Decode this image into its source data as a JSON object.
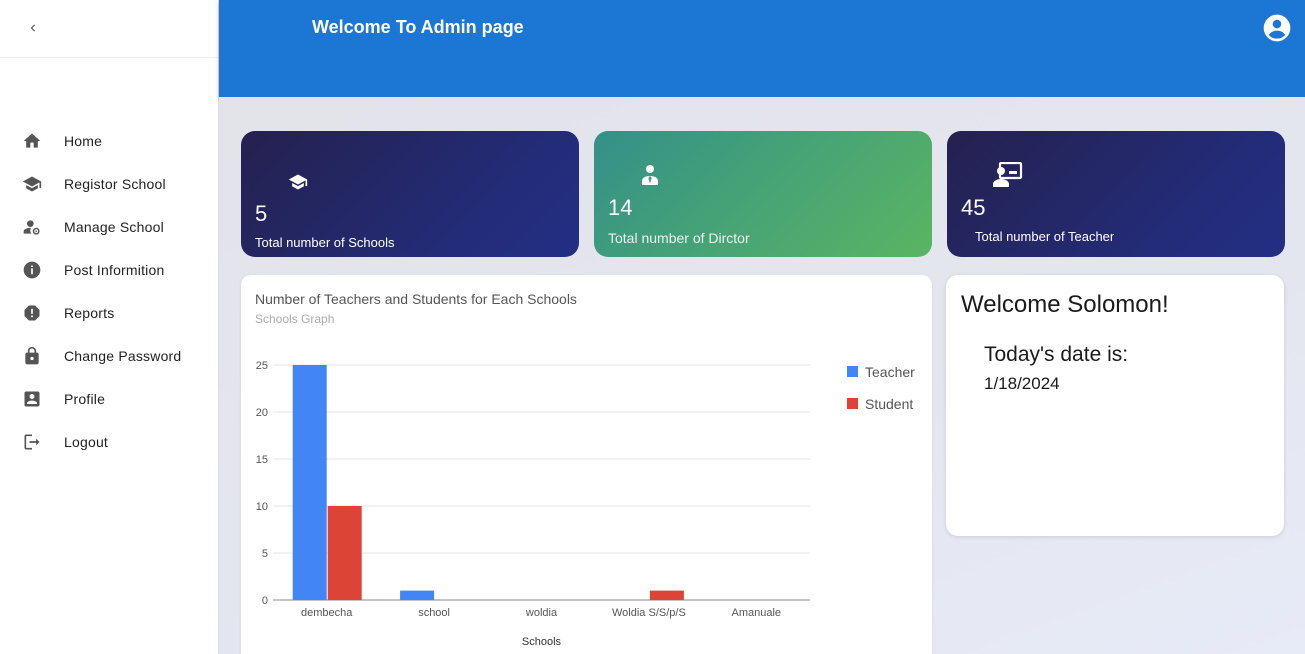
{
  "sidebar": {
    "items": [
      {
        "label": "Home",
        "icon": "home-icon"
      },
      {
        "label": "Registor School",
        "icon": "school-icon"
      },
      {
        "label": "Manage School",
        "icon": "manage-accounts-icon"
      },
      {
        "label": "Post Informition",
        "icon": "info-icon"
      },
      {
        "label": "Reports",
        "icon": "report-icon"
      },
      {
        "label": "Change Password",
        "icon": "lock-icon"
      },
      {
        "label": "Profile",
        "icon": "account-box-icon"
      },
      {
        "label": "Logout",
        "icon": "logout-icon"
      }
    ]
  },
  "header": {
    "title": "Welcome To Admin page"
  },
  "stats": {
    "schools": {
      "value": "5",
      "caption": "Total number of Schools"
    },
    "director": {
      "value": "14",
      "caption": "Total number of Dirctor"
    },
    "teacher": {
      "value": "45",
      "caption": "Total number of Teacher"
    }
  },
  "colors": {
    "accent": "#1b76d4",
    "teacher": "#4285f4",
    "student": "#db4437"
  },
  "chart_data": {
    "type": "bar",
    "title": "Number of Teachers and Students for Each Schools",
    "subtitle": "Schools Graph",
    "xlabel": "Schools",
    "ylabel": "",
    "categories": [
      "dembecha",
      "school",
      "woldia",
      "Woldia S/S/p/S",
      "Amanuale"
    ],
    "series": [
      {
        "name": "Teacher",
        "values": [
          25,
          1,
          0,
          0,
          0
        ]
      },
      {
        "name": "Student",
        "values": [
          10,
          0,
          0,
          1,
          0
        ]
      }
    ],
    "ylim": [
      0,
      25
    ],
    "yticks": [
      0,
      5,
      10,
      15,
      20,
      25
    ],
    "grid": true,
    "legend": "right"
  },
  "welcome": {
    "title": "Welcome Solomon!",
    "date_label": "Today's date is:",
    "date_value": "1/18/2024"
  }
}
